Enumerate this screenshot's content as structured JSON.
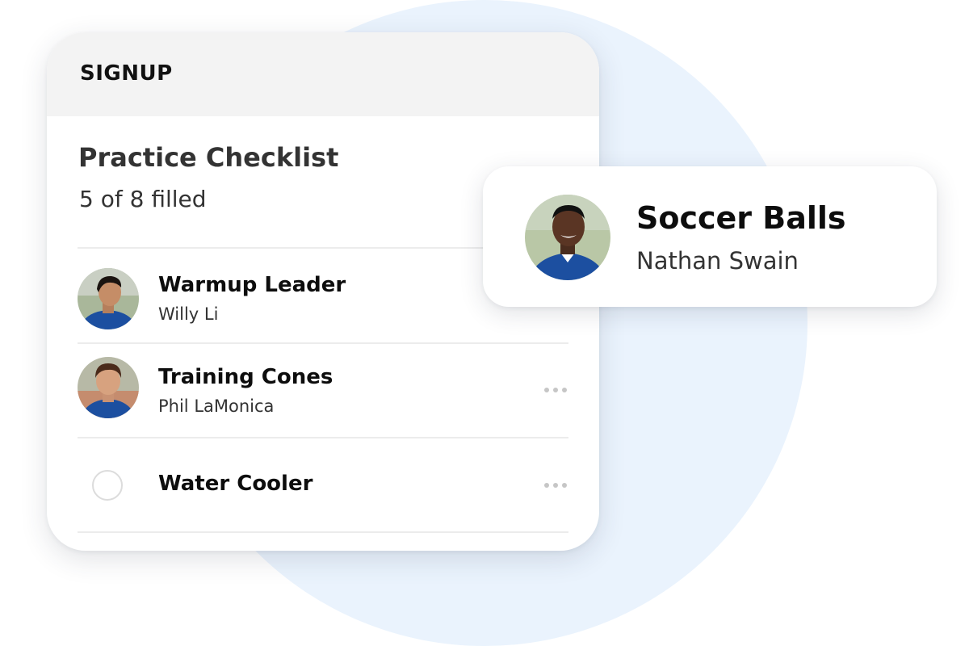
{
  "signup": {
    "header_title": "SIGNUP"
  },
  "checklist": {
    "title": "Practice Checklist",
    "subtitle": "5 of 8 filled",
    "items": [
      {
        "title": "Warmup Leader",
        "name": "Willy Li"
      },
      {
        "title": "Training Cones",
        "name": "Phil LaMonica"
      },
      {
        "title": "Water Cooler",
        "name": ""
      }
    ]
  },
  "popup": {
    "title": "Soccer Balls",
    "name": "Nathan Swain"
  },
  "icons": [
    "avatar",
    "more-icon",
    "empty-checkbox-circle"
  ],
  "colors": {
    "background_circle": "#eaf3fd",
    "header_bg": "#f3f3f3",
    "jersey_blue": "#1c4fa0"
  }
}
